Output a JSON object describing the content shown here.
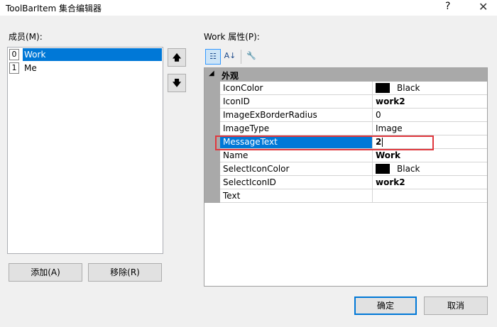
{
  "window": {
    "title": "ToolBarItem 集合编辑器",
    "help_glyph": "?",
    "close_glyph": "✕"
  },
  "members": {
    "label": "成员(M):",
    "items": [
      {
        "index": "0",
        "name": "Work",
        "selected": true
      },
      {
        "index": "1",
        "name": "Me",
        "selected": false
      }
    ],
    "move_up_glyph": "🡅",
    "move_down_glyph": "🡇",
    "add_button": "添加(A)",
    "remove_button": "移除(R)"
  },
  "properties": {
    "label": "Work 属性(P):",
    "toolbar": {
      "categorized_glyph": "☷",
      "alphabetical_glyph": "A↓",
      "property_pages_glyph": "🔧"
    },
    "category": {
      "name": "外观",
      "arrow": "◢"
    },
    "rows": [
      {
        "name": "IconColor",
        "value": "Black",
        "swatch": "#000000",
        "bold": false
      },
      {
        "name": "IconID",
        "value": "work2",
        "bold": true
      },
      {
        "name": "ImageExBorderRadius",
        "value": "0",
        "bold": false
      },
      {
        "name": "ImageType",
        "value": "Image",
        "bold": false
      },
      {
        "name": "MessageText",
        "value": "2",
        "bold": true,
        "editing": true
      },
      {
        "name": "Name",
        "value": "Work",
        "bold": true
      },
      {
        "name": "SelectIconColor",
        "value": "Black",
        "swatch": "#000000",
        "bold": false
      },
      {
        "name": "SelectIconID",
        "value": "work2",
        "bold": true
      },
      {
        "name": "Text",
        "value": "",
        "bold": false
      }
    ]
  },
  "footer": {
    "ok_button": "确定",
    "cancel_button": "取消"
  },
  "colors": {
    "selection": "#0078d7",
    "highlight_border": "#e0383e",
    "category_bg": "#a9a9a9"
  }
}
